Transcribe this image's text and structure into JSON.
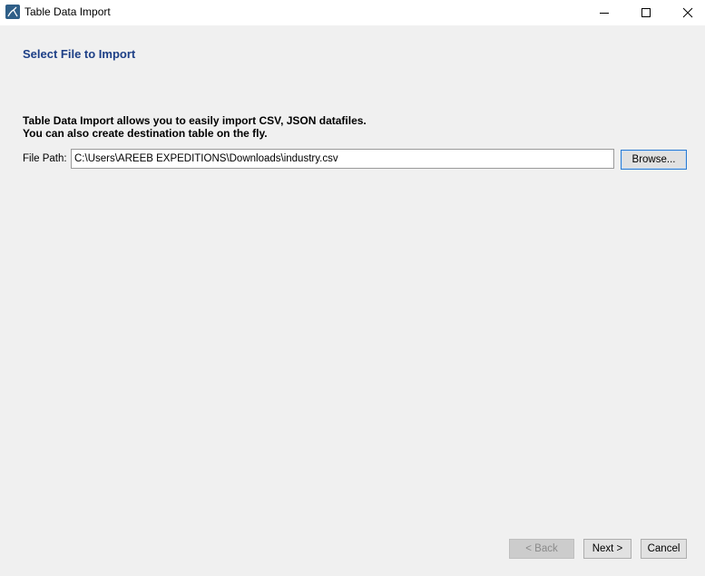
{
  "window": {
    "title": "Table Data Import",
    "app_icon": "mysql-workbench-icon",
    "minimize_icon": "minimize-icon",
    "maximize_icon": "maximize-icon",
    "close_icon": "close-icon"
  },
  "page": {
    "title": "Select File to Import",
    "description_line1": "Table Data Import allows you to easily import CSV, JSON datafiles.",
    "description_line2": "You can also create destination table on the fly."
  },
  "file_path": {
    "label": "File Path:",
    "value": "C:\\Users\\AREEB EXPEDITIONS\\Downloads\\industry.csv",
    "browse_label": "Browse..."
  },
  "footer": {
    "back_label": "< Back",
    "back_enabled": false,
    "next_label": "Next >",
    "cancel_label": "Cancel"
  },
  "colors": {
    "title_blue": "#1d3f86",
    "background": "#f0f0f0",
    "focus_blue": "#2b7bd1"
  }
}
